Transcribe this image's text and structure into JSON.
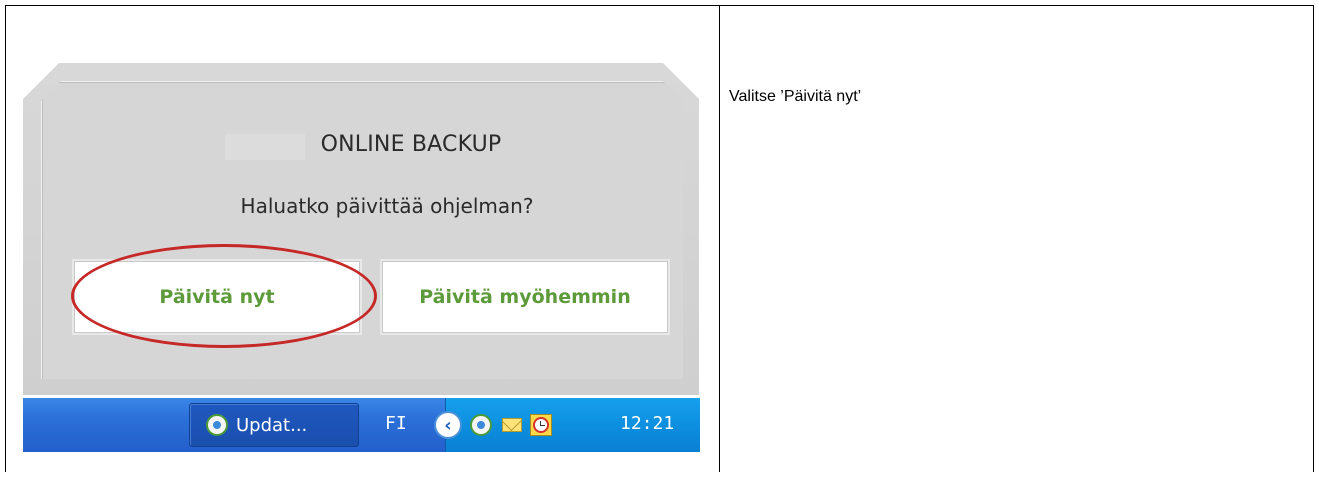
{
  "instruction": {
    "text": "Valitse ’Päivitä nyt’"
  },
  "dialog": {
    "title": "ONLINE BACKUP",
    "question": "Haluatko päivittää ohjelman?",
    "update_now_label": "Päivitä nyt",
    "update_later_label": "Päivitä myöhemmin"
  },
  "taskbar": {
    "task_label": "Updat...",
    "language": "FI",
    "clock": "12:21",
    "tray_icons": [
      "show-hidden-icons-chevron",
      "backup-app-icon",
      "mail-icon",
      "clock-icon"
    ]
  },
  "colors": {
    "button_text": "#5c9a3a",
    "highlight": "#c62828",
    "taskbar": "#245fcb",
    "tray": "#0d8fe0"
  }
}
